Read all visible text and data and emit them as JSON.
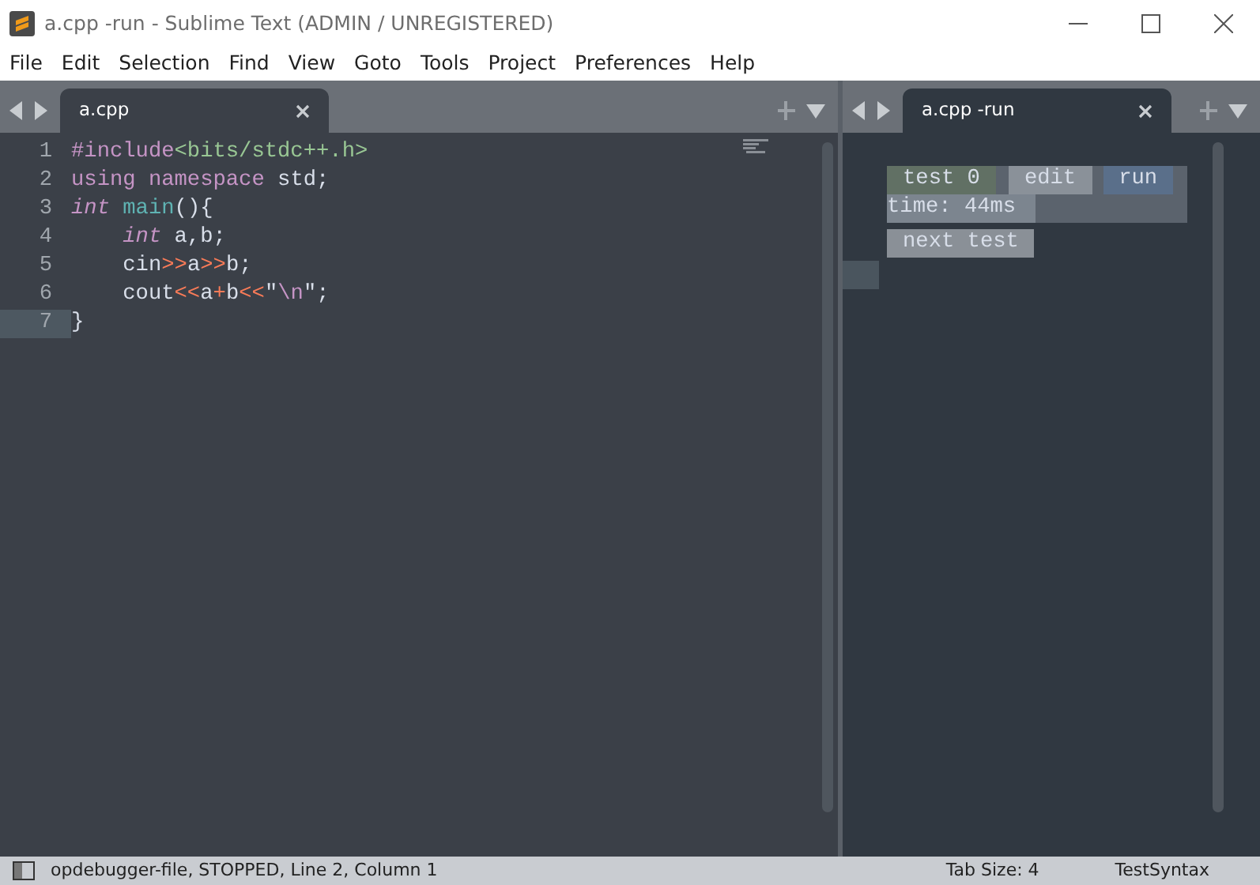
{
  "window": {
    "title": "a.cpp -run - Sublime Text (ADMIN / UNREGISTERED)"
  },
  "menu": [
    "File",
    "Edit",
    "Selection",
    "Find",
    "View",
    "Goto",
    "Tools",
    "Project",
    "Preferences",
    "Help"
  ],
  "left_pane": {
    "tabs": [
      {
        "label": "a.cpp",
        "selected": true
      }
    ],
    "lines": [
      {
        "number": "1",
        "current": false,
        "tokens": [
          {
            "kind": "preproc",
            "text": "#include"
          },
          {
            "kind": "string",
            "text": "<bits/stdc++.h>"
          }
        ]
      },
      {
        "number": "2",
        "current": false,
        "tokens": [
          {
            "kind": "keyword",
            "text": "using namespace"
          },
          {
            "kind": "plain",
            "text": " std;"
          }
        ]
      },
      {
        "number": "3",
        "current": false,
        "tokens": [
          {
            "kind": "type",
            "text": "int"
          },
          {
            "kind": "function",
            "text": " main"
          },
          {
            "kind": "plain",
            "text": "(){"
          }
        ]
      },
      {
        "number": "4",
        "current": false,
        "tokens": [
          {
            "kind": "type",
            "text": "    int"
          },
          {
            "kind": "plain",
            "text": " a,b;"
          }
        ]
      },
      {
        "number": "5",
        "current": false,
        "tokens": [
          {
            "kind": "plain",
            "text": "    cin"
          },
          {
            "kind": "operator",
            "text": ">>"
          },
          {
            "kind": "plain",
            "text": "a"
          },
          {
            "kind": "operator",
            "text": ">>"
          },
          {
            "kind": "plain",
            "text": "b;"
          }
        ]
      },
      {
        "number": "6",
        "current": false,
        "tokens": [
          {
            "kind": "plain",
            "text": "    cout"
          },
          {
            "kind": "operator",
            "text": "<<"
          },
          {
            "kind": "plain",
            "text": "a"
          },
          {
            "kind": "operator",
            "text": "+"
          },
          {
            "kind": "plain",
            "text": "b"
          },
          {
            "kind": "operator",
            "text": "<<"
          },
          {
            "kind": "plain",
            "text": "\""
          },
          {
            "kind": "escape",
            "text": "\\n"
          },
          {
            "kind": "plain",
            "text": "\";"
          }
        ]
      },
      {
        "number": "7",
        "current": true,
        "tokens": [
          {
            "kind": "plain",
            "text": "}"
          }
        ]
      }
    ]
  },
  "right_pane": {
    "tabs": [
      {
        "label": "a.cpp -run",
        "selected": true
      }
    ],
    "test_label": "test 0",
    "edit_button": "edit",
    "run_button": "run",
    "time": "time: 44ms",
    "next_button": "next test"
  },
  "status_bar": {
    "left": "opdebugger-file, STOPPED, Line 2, Column 1",
    "tab_size": "Tab Size: 4",
    "syntax": "TestSyntax"
  }
}
